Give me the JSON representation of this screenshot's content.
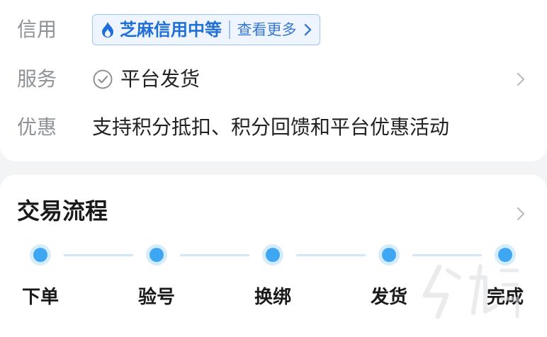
{
  "info": {
    "credit": {
      "label": "信用",
      "badge_title": "芝麻信用中等",
      "badge_more": "查看更多"
    },
    "service": {
      "label": "服务",
      "value": "平台发货"
    },
    "discount": {
      "label": "优惠",
      "value": "支持积分抵扣、积分回馈和平台优惠活动"
    }
  },
  "process": {
    "title": "交易流程",
    "steps": [
      "下单",
      "验号",
      "换绑",
      "发货",
      "完成"
    ]
  },
  "colors": {
    "accent_blue": "#1f6fd6",
    "dot_blue": "#3ea7f4",
    "label_gray": "#8e9196",
    "background": "#f3f4f6"
  },
  "icons": {
    "credit": "flame-icon",
    "service": "check-circle-icon",
    "arrow": "chevron-right-icon"
  }
}
